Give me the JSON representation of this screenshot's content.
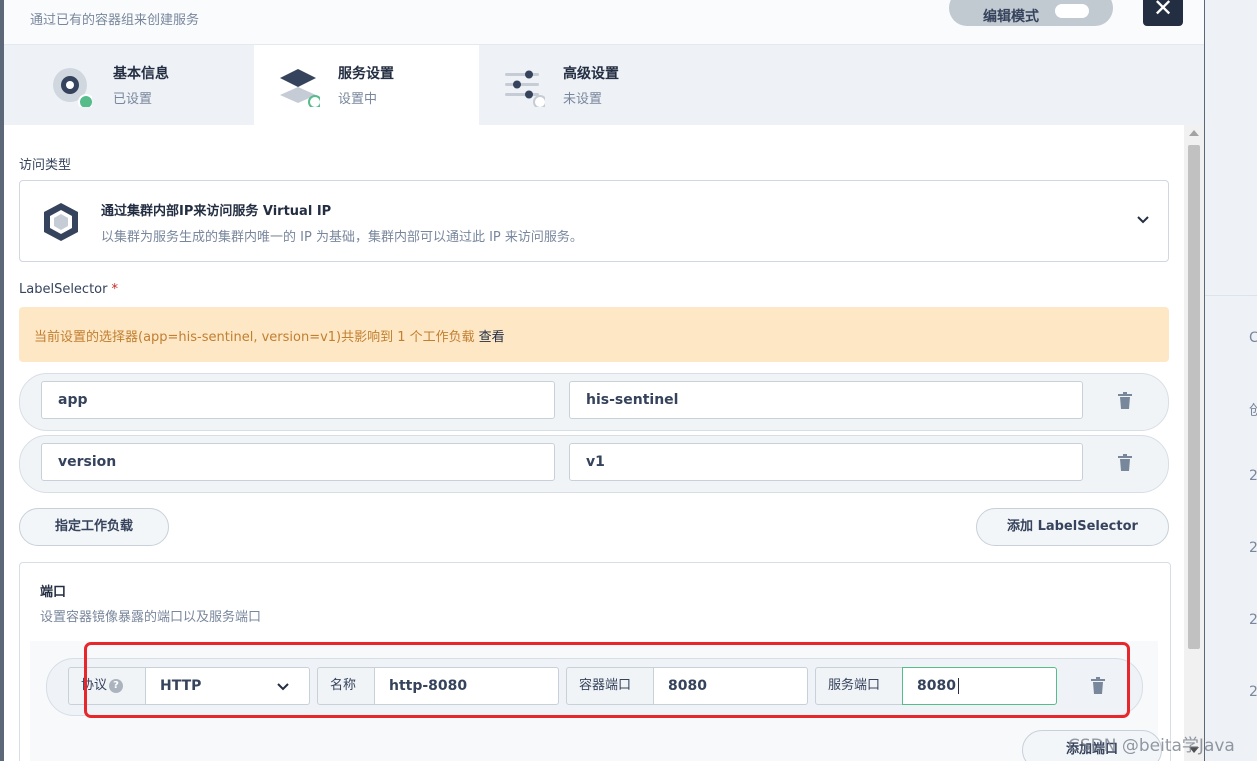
{
  "header": {
    "subtitle": "通过已有的容器组来创建服务",
    "edit_mode_label": "编辑模式",
    "close_symbol": "✕"
  },
  "steps": [
    {
      "title": "基本信息",
      "status": "已设置",
      "icon": "basic-info-icon"
    },
    {
      "title": "服务设置",
      "status": "设置中",
      "icon": "service-settings-icon"
    },
    {
      "title": "高级设置",
      "status": "未设置",
      "icon": "advanced-settings-icon"
    }
  ],
  "access": {
    "label": "访问类型",
    "title": "通过集群内部IP来访问服务 Virtual IP",
    "description": "以集群为服务生成的集群内唯一的 IP 为基础，集群内部可以通过此 IP 来访问服务。"
  },
  "label_selector": {
    "label": "LabelSelector",
    "required_mark": "*",
    "notice": "当前设置的选择器(app=his-sentinel, version=v1)共影响到 1 个工作负载",
    "notice_link": "查看",
    "rows": [
      {
        "key": "app",
        "value": "his-sentinel"
      },
      {
        "key": "version",
        "value": "v1"
      }
    ],
    "assign_workload_button": "指定工作负载",
    "add_button": "添加 LabelSelector"
  },
  "ports": {
    "title": "端口",
    "description": "设置容器镜像暴露的端口以及服务端口",
    "protocol_label": "协议",
    "help_symbol": "?",
    "protocol_value": "HTTP",
    "name_label": "名称",
    "name_value": "http-8080",
    "container_port_label": "容器端口",
    "container_port_value": "8080",
    "service_port_label": "服务端口",
    "service_port_value": "8080",
    "add_button": "添加端口"
  },
  "watermark": "CSDN @beita学Java",
  "colors": {
    "accent_green": "#55bc8a",
    "highlight_red": "#e8272c",
    "warning_bg": "#fde7c5",
    "warning_text": "#c17f31",
    "dark": "#242e42"
  },
  "background_right_chars": [
    "C",
    "创",
    "2",
    "2",
    "2",
    "2",
    "2"
  ]
}
